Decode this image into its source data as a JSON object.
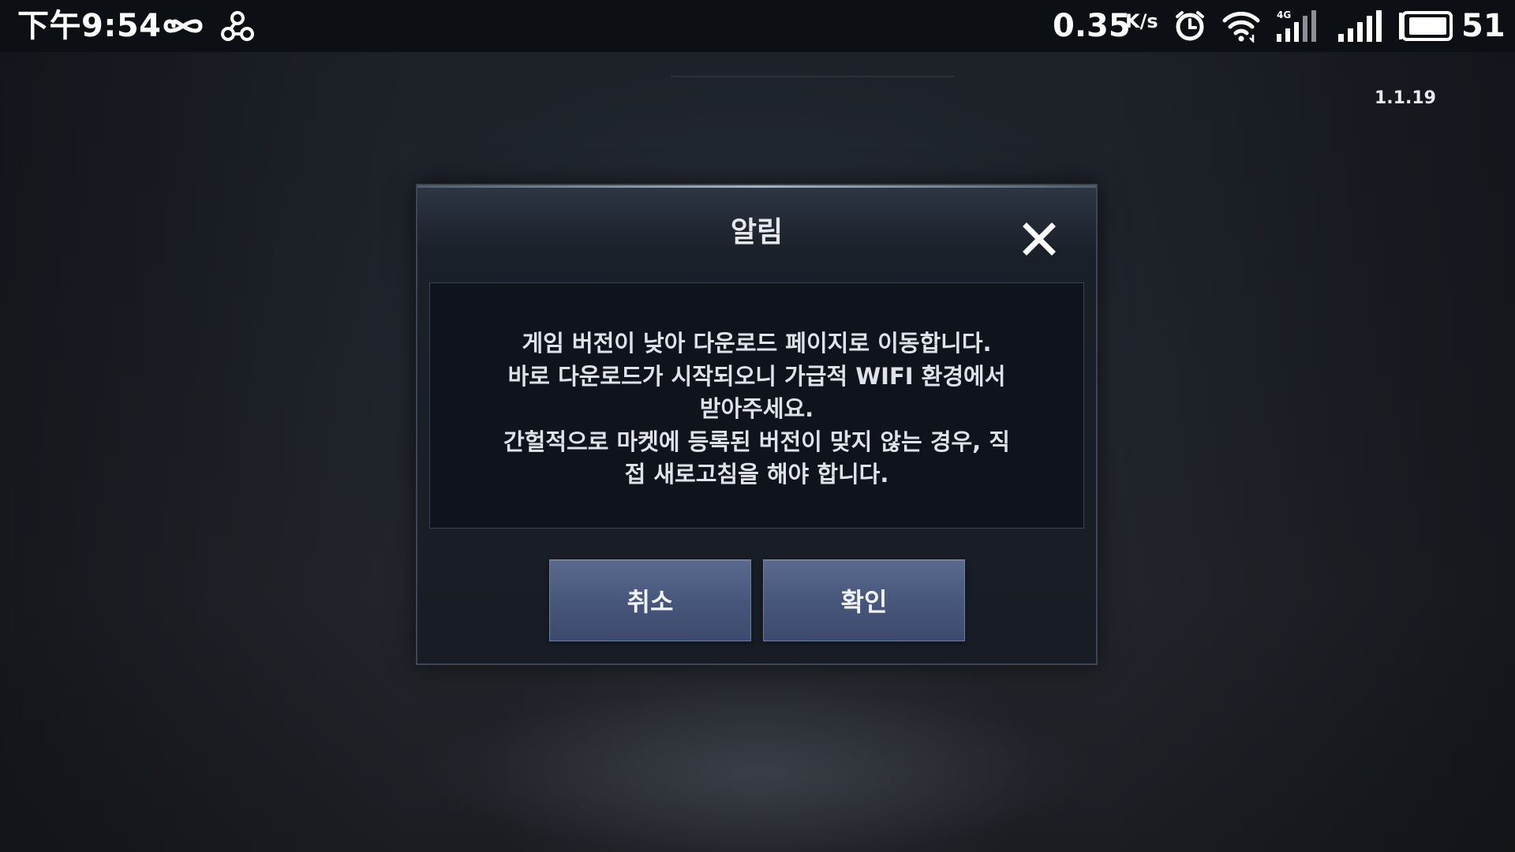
{
  "status_bar": {
    "time": "下午9:54",
    "network_speed": "0.35",
    "network_speed_unit": "K/s",
    "network_type": "4G",
    "battery_level": "51",
    "icons": [
      "infinity-icon",
      "share-icon",
      "alarm-icon",
      "wifi-icon",
      "signal-4g-icon",
      "signal-icon",
      "battery-icon"
    ]
  },
  "version": "1.1.19",
  "dialog": {
    "title": "알림",
    "message": "게임 버전이 낮아 다운로드 페이지로 이동합니다.\n바로 다운로드가 시작되오니 가급적 WIFI 환경에서\n받아주세요.\n간헐적으로 마켓에 등록된 버전이 맞지 않는 경우, 직\n접 새로고침을 해야 합니다.",
    "cancel_label": "취소",
    "confirm_label": "확인",
    "close_icon": "close-icon"
  },
  "colors": {
    "button_blue": "#4a5a80",
    "dialog_bg": "#171c25",
    "message_bg": "#0f131c",
    "status_bar_bg": "#0c0f13"
  }
}
